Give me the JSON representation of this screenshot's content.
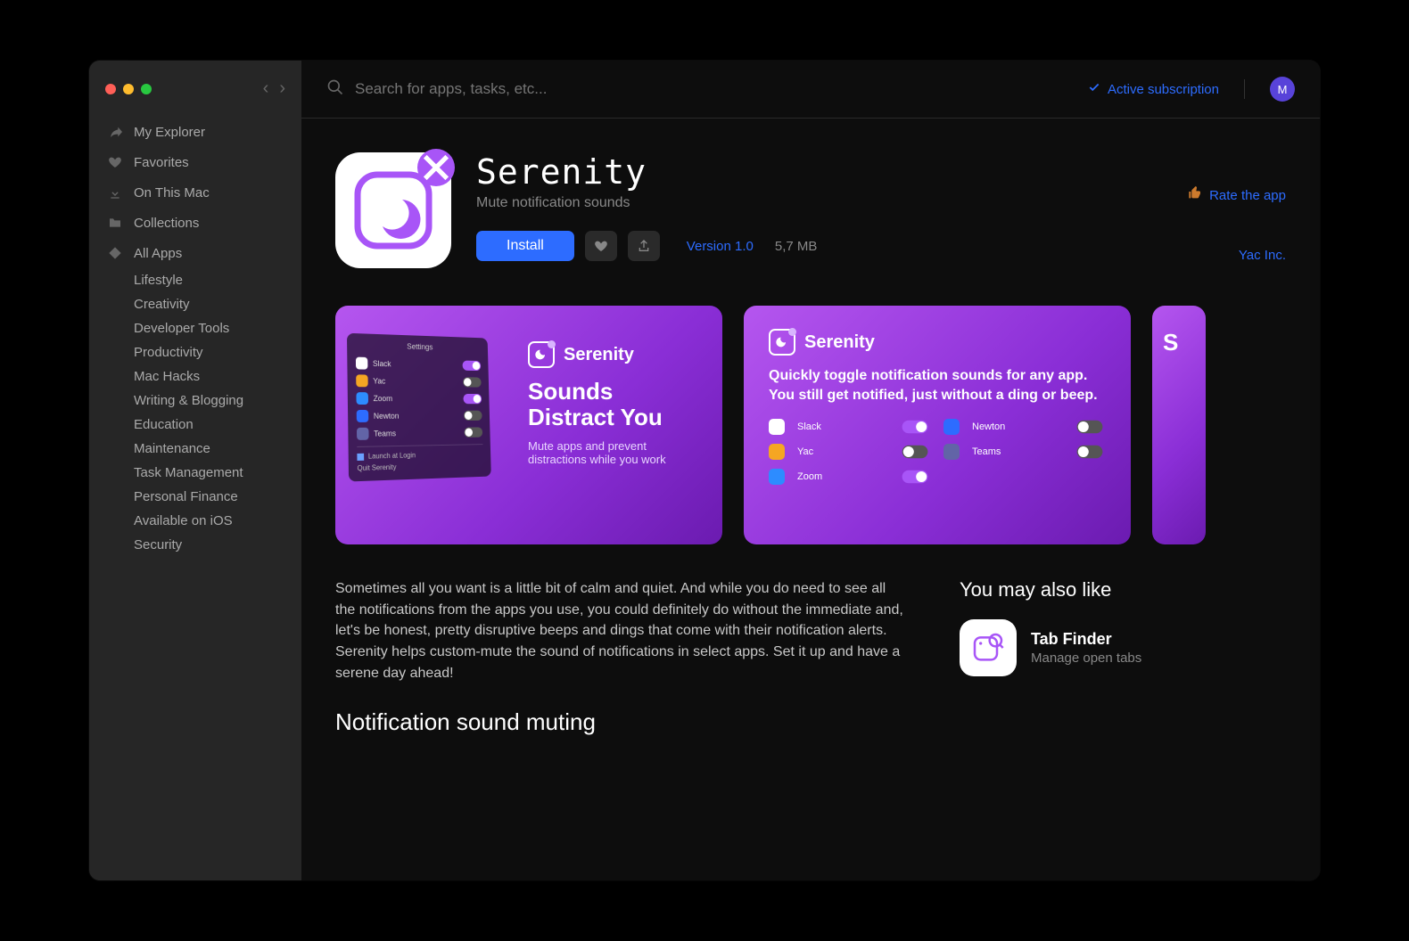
{
  "search": {
    "placeholder": "Search for apps, tasks, etc..."
  },
  "subscription_label": "Active subscription",
  "avatar_initial": "M",
  "sidebar": {
    "main": [
      {
        "label": "My Explorer",
        "icon": "leaf"
      },
      {
        "label": "Favorites",
        "icon": "heart"
      },
      {
        "label": "On This Mac",
        "icon": "download"
      },
      {
        "label": "Collections",
        "icon": "folder"
      },
      {
        "label": "All Apps",
        "icon": "diamond"
      }
    ],
    "categories": [
      "Lifestyle",
      "Creativity",
      "Developer Tools",
      "Productivity",
      "Mac Hacks",
      "Writing & Blogging",
      "Education",
      "Maintenance",
      "Task Management",
      "Personal Finance",
      "Available on iOS",
      "Security"
    ]
  },
  "app": {
    "name": "Serenity",
    "tagline": "Mute notification sounds",
    "install_label": "Install",
    "version_label": "Version 1.0",
    "size": "5,7 MB",
    "vendor": "Yac Inc.",
    "rate_label": "Rate the app"
  },
  "cards": {
    "c1_brand": "Serenity",
    "c1_headline": "Sounds Distract You",
    "c1_sub": "Mute apps and prevent distractions while you work",
    "c1_panel": {
      "title": "Settings",
      "rows": [
        {
          "name": "Slack",
          "on": true,
          "color": "#fff"
        },
        {
          "name": "Yac",
          "on": false,
          "color": "#f5a623"
        },
        {
          "name": "Zoom",
          "on": true,
          "color": "#2d8cff"
        },
        {
          "name": "Newton",
          "on": false,
          "color": "#2d6cff"
        },
        {
          "name": "Teams",
          "on": false,
          "color": "#6264a7"
        }
      ],
      "launch": "Launch at Login",
      "quit": "Quit Serenity"
    },
    "c2_brand": "Serenity",
    "c2_desc": "Quickly toggle notification sounds for any app. You still get notified, just without a ding or beep.",
    "c2_apps_left": [
      {
        "name": "Slack",
        "on": true,
        "color": "#fff"
      },
      {
        "name": "Yac",
        "on": false,
        "color": "#f5a623"
      },
      {
        "name": "Zoom",
        "on": true,
        "color": "#2d8cff"
      }
    ],
    "c2_apps_right": [
      {
        "name": "Newton",
        "on": false,
        "color": "#2d6cff"
      },
      {
        "name": "Teams",
        "on": false,
        "color": "#6264a7"
      }
    ]
  },
  "description": "Sometimes all you want is a little bit of calm and quiet. And while you do need to see all the notifications from the apps you use, you could definitely do without the immediate and, let's be honest, pretty disruptive beeps and dings that come with their notification alerts. Serenity helps custom-mute the sound of notifications in select apps. Set it up and have a serene day ahead!",
  "section_heading": "Notification sound muting",
  "also": {
    "heading": "You may also like",
    "item": {
      "name": "Tab Finder",
      "sub": "Manage open tabs"
    }
  }
}
